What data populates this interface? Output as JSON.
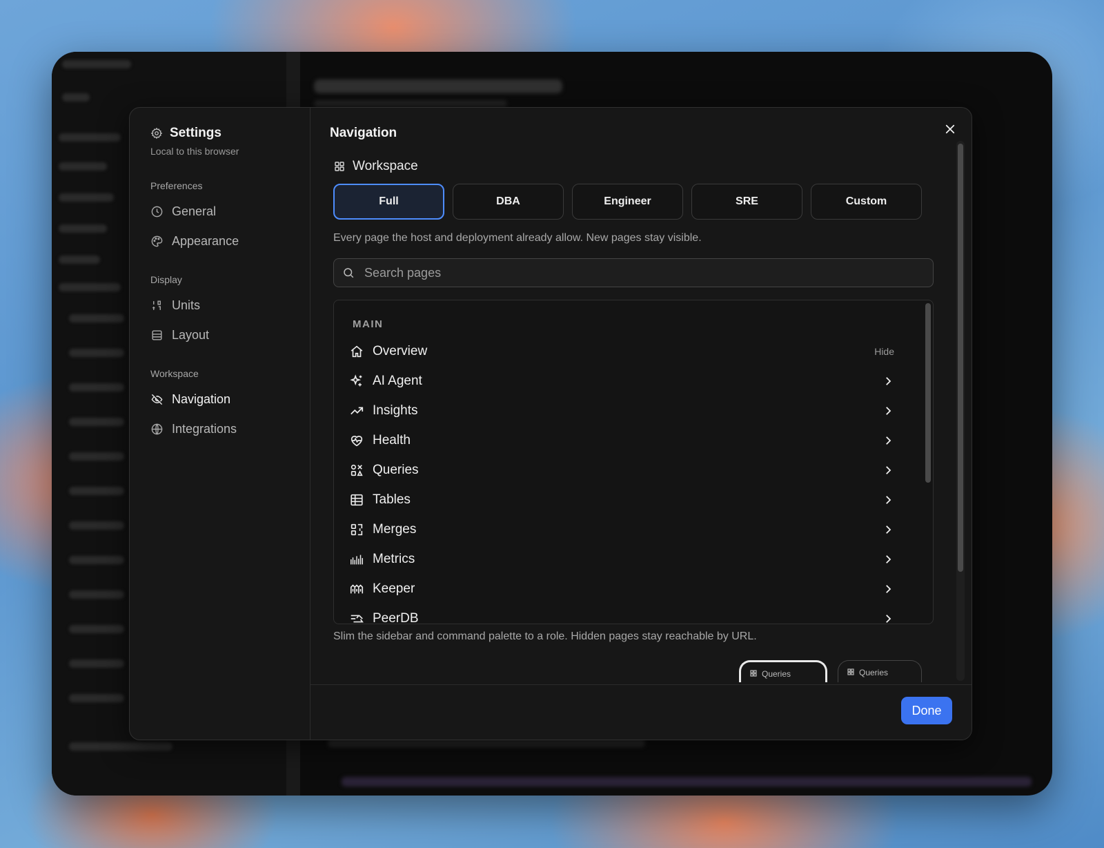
{
  "sidebar": {
    "title": "Settings",
    "subtitle": "Local to this browser",
    "sections": [
      {
        "label": "Preferences",
        "items": [
          "General",
          "Appearance"
        ]
      },
      {
        "label": "Display",
        "items": [
          "Units",
          "Layout"
        ]
      },
      {
        "label": "Workspace",
        "items": [
          "Navigation",
          "Integrations"
        ]
      }
    ],
    "active_item": "Navigation"
  },
  "main": {
    "title": "Navigation",
    "workspace_heading": "Workspace",
    "presets": [
      "Full",
      "DBA",
      "Engineer",
      "SRE",
      "Custom"
    ],
    "selected_preset": "Full",
    "preset_description": "Every page the host and deployment already allow. New pages stay visible.",
    "search": {
      "placeholder": "Search pages",
      "value": ""
    },
    "list": {
      "group_label": "MAIN",
      "rows": [
        {
          "label": "Overview",
          "action": "Hide",
          "icon": "home-icon"
        },
        {
          "label": "AI Agent",
          "icon": "sparkles-icon"
        },
        {
          "label": "Insights",
          "icon": "trending-up-icon"
        },
        {
          "label": "Health",
          "icon": "heart-pulse-icon"
        },
        {
          "label": "Queries",
          "icon": "queries-icon"
        },
        {
          "label": "Tables",
          "icon": "table-icon"
        },
        {
          "label": "Merges",
          "icon": "merge-icon"
        },
        {
          "label": "Metrics",
          "icon": "bars-icon"
        },
        {
          "label": "Keeper",
          "icon": "keeper-icon"
        },
        {
          "label": "PeerDB",
          "icon": "peerdb-icon"
        }
      ]
    },
    "footer_description": "Slim the sidebar and command palette to a role. Hidden pages stay reachable by URL.",
    "preview_chips": [
      "Queries",
      "Queries"
    ]
  },
  "footer": {
    "done_label": "Done"
  },
  "colors": {
    "accent": "#3b73f0",
    "selected_border": "#4e8dff"
  }
}
